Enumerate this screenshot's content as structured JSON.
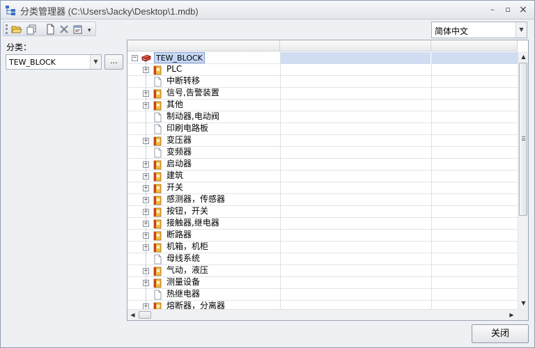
{
  "window": {
    "title": "分类管理器 (C:\\Users\\Jacky\\Desktop\\1.mdb)",
    "minimize_glyph": "–",
    "maximize_glyph": "▫",
    "close_glyph": "×"
  },
  "toolbar": {
    "buttons": [
      "open-folder-icon",
      "copy-icon",
      "new-document-icon",
      "delete-icon",
      "properties-icon"
    ],
    "more_glyph": "▾"
  },
  "language": {
    "selected": "简体中文"
  },
  "category": {
    "label": "分类：",
    "selected": "TEW_BLOCK",
    "browse_label": "..."
  },
  "tree": {
    "root": {
      "label": "TEW_BLOCK",
      "expanded": true
    },
    "items": [
      {
        "label": "PLC",
        "expandable": true
      },
      {
        "label": "中断转移",
        "expandable": false
      },
      {
        "label": "信号,告警装置",
        "expandable": true
      },
      {
        "label": "其他",
        "expandable": true
      },
      {
        "label": "制动器,电动阀",
        "expandable": false
      },
      {
        "label": "印刷电路板",
        "expandable": false
      },
      {
        "label": "变压器",
        "expandable": true
      },
      {
        "label": "变频器",
        "expandable": false
      },
      {
        "label": "启动器",
        "expandable": true
      },
      {
        "label": "建筑",
        "expandable": true
      },
      {
        "label": "开关",
        "expandable": true
      },
      {
        "label": "感测器，传感器",
        "expandable": true
      },
      {
        "label": "按钮，开关",
        "expandable": true
      },
      {
        "label": "接触器,继电器",
        "expandable": true
      },
      {
        "label": "断路器",
        "expandable": true
      },
      {
        "label": "机箱，机柜",
        "expandable": true
      },
      {
        "label": "母线系统",
        "expandable": false
      },
      {
        "label": "气动，液压",
        "expandable": true
      },
      {
        "label": "测量设备",
        "expandable": true
      },
      {
        "label": "热继电器",
        "expandable": false
      },
      {
        "label": "熔断器，分离器",
        "expandable": true
      }
    ]
  },
  "scroll": {
    "vertical_position": 0.0,
    "horizontal_position": 0.0
  },
  "footer": {
    "close_label": "关闭"
  },
  "colors": {
    "selection": "#c6d8f5",
    "folder_icon": "#e6a23c",
    "root_icon": "#c0392b"
  }
}
